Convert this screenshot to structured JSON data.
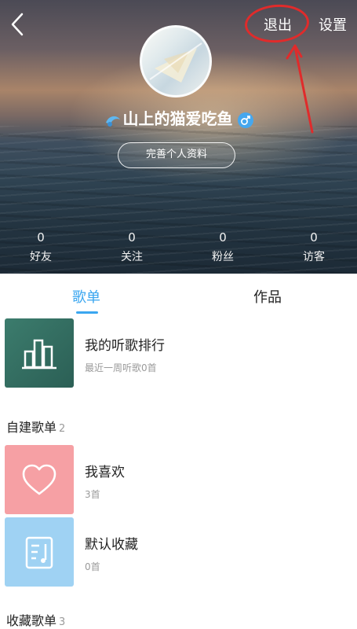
{
  "header": {
    "back_icon": "chevron-left-icon",
    "logout_label": "退出",
    "settings_label": "设置",
    "annotation_color": "#e02b2b"
  },
  "profile": {
    "username": "山上的猫爱吃鱼",
    "gender_icon": "male-icon",
    "edit_profile_label": "完善个人资料"
  },
  "stats": [
    {
      "value": "0",
      "label": "好友"
    },
    {
      "value": "0",
      "label": "关注"
    },
    {
      "value": "0",
      "label": "粉丝"
    },
    {
      "value": "0",
      "label": "访客"
    }
  ],
  "tabs": [
    {
      "label": "歌单",
      "active": true
    },
    {
      "label": "作品",
      "active": false
    }
  ],
  "ranking": {
    "title": "我的听歌排行",
    "subtitle": "最近一周听歌0首",
    "icon": "bar-chart-icon"
  },
  "created_playlists": {
    "header": "自建歌单",
    "count": "2",
    "items": [
      {
        "title": "我喜欢",
        "subtitle": "3首",
        "icon": "heart-icon"
      },
      {
        "title": "默认收藏",
        "subtitle": "0首",
        "icon": "music-note-icon"
      }
    ]
  },
  "collected_playlists": {
    "header": "收藏歌单",
    "count": "3"
  },
  "colors": {
    "accent": "#3aa6f0",
    "ranking_thumb": "#2f6d60",
    "liked_thumb": "#f6a0a4",
    "default_thumb": "#9fd2f3"
  }
}
